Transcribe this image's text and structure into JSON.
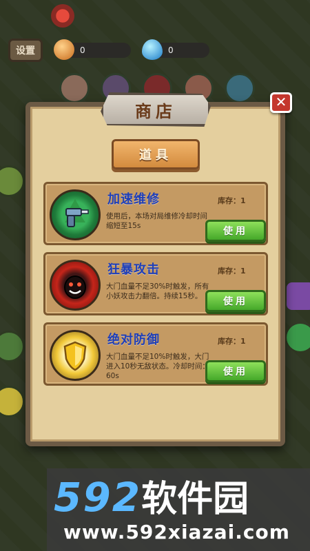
{
  "top_bar": {
    "settings_label": "设置",
    "coins": "0",
    "gems": "0",
    "coin_icon": "coin-icon",
    "gem_icon": "water-drop-icon"
  },
  "shop": {
    "title": "商店",
    "tab_label": "道具",
    "close_label": "✕",
    "items": [
      {
        "name": "加速维修",
        "stock": "库存：1",
        "description": "使用后，本场对局维修冷却时间缩短至15s",
        "use_label": "使用",
        "icon": "drill-icon"
      },
      {
        "name": "狂暴攻击",
        "stock": "库存：1",
        "description": "大门血量不足30%时触发，所有小妖攻击力翻倍。持续15秒。",
        "use_label": "使用",
        "icon": "rage-demon-icon"
      },
      {
        "name": "绝对防御",
        "stock": "库存：1",
        "description": "大门血量不足10%时触发，大门进入10秒无敌状态。冷却时间：60s",
        "use_label": "使用",
        "icon": "golden-shield-icon"
      }
    ]
  },
  "watermark": {
    "logo_number": "592",
    "logo_text": "软件园",
    "url": "www.592xiazai.com"
  },
  "colors": {
    "panel": "#e4cf9e",
    "card": "#c49a63",
    "item_name": "#1f3fb8",
    "use_button": "#45a82a",
    "close_button": "#c4372d"
  }
}
